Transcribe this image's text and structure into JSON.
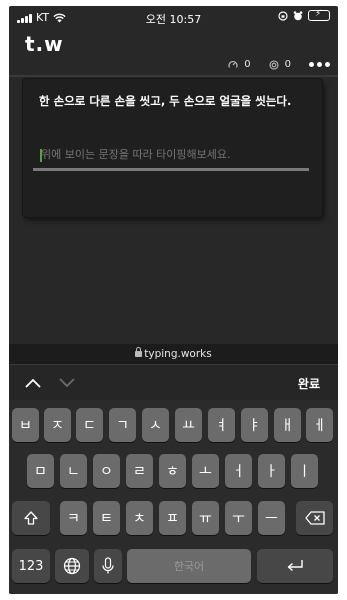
{
  "status_bar": {
    "carrier": "KT",
    "time": "오전 10:57"
  },
  "app": {
    "logo": "t.w",
    "speed_value": "0",
    "accuracy_value": "0"
  },
  "typing": {
    "sentence": "한 손으로 다른 손을 씻고, 두 손으로 얼굴을 씻는다.",
    "placeholder": "위에 보이는 문장을 따라 타이핑해보세요."
  },
  "browser": {
    "url": "typing.works"
  },
  "accessory": {
    "done_label": "완료"
  },
  "keyboard": {
    "row1": [
      "ㅂ",
      "ㅈ",
      "ㄷ",
      "ㄱ",
      "ㅅ",
      "ㅛ",
      "ㅕ",
      "ㅑ",
      "ㅐ",
      "ㅔ"
    ],
    "row2": [
      "ㅁ",
      "ㄴ",
      "ㅇ",
      "ㄹ",
      "ㅎ",
      "ㅗ",
      "ㅓ",
      "ㅏ",
      "ㅣ"
    ],
    "row3": [
      "ㅋ",
      "ㅌ",
      "ㅊ",
      "ㅍ",
      "ㅠ",
      "ㅜ",
      "ㅡ"
    ],
    "numbers_label": "123",
    "space_label": "한국어"
  }
}
